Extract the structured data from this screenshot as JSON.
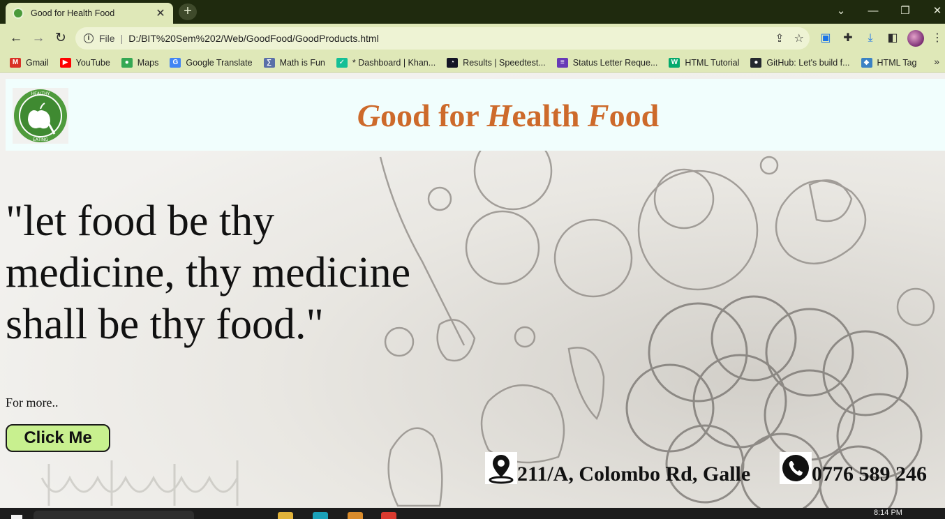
{
  "browser": {
    "tab_title": "Good for Health Food",
    "tab_close": "✕",
    "new_tab": "+",
    "address_scheme": "File",
    "address_sep": "|",
    "address_url": "D:/BIT%20Sem%202/Web/GoodFood/GoodProducts.html",
    "bookmarks": [
      {
        "label": "Gmail",
        "icon": "gmail-icon",
        "color": "#d93025",
        "glyph": "M"
      },
      {
        "label": "YouTube",
        "icon": "youtube-icon",
        "color": "#ff0000",
        "glyph": "▶"
      },
      {
        "label": "Maps",
        "icon": "maps-icon",
        "color": "#34a853",
        "glyph": "●"
      },
      {
        "label": "Google Translate",
        "icon": "translate-icon",
        "color": "#4285f4",
        "glyph": "G"
      },
      {
        "label": "Math is Fun",
        "icon": "mathisfun-icon",
        "color": "#5a6fa8",
        "glyph": "∑"
      },
      {
        "label": "* Dashboard | Khan...",
        "icon": "khan-icon",
        "color": "#14bf96",
        "glyph": "✓"
      },
      {
        "label": "Results | Speedtest...",
        "icon": "speedtest-icon",
        "color": "#141526",
        "glyph": "◔"
      },
      {
        "label": "Status Letter Reque...",
        "icon": "forms-icon",
        "color": "#673ab7",
        "glyph": "≡"
      },
      {
        "label": "HTML Tutorial",
        "icon": "w3schools-icon",
        "color": "#04aa6d",
        "glyph": "W"
      },
      {
        "label": "GitHub: Let's build f...",
        "icon": "github-icon",
        "color": "#24292f",
        "glyph": "●"
      },
      {
        "label": "HTML  Tag",
        "icon": "html-tag-icon",
        "color": "#3b82c4",
        "glyph": "◆"
      }
    ],
    "bookmarks_more": "»"
  },
  "page": {
    "title_parts": [
      {
        "text": "G",
        "italic": true
      },
      {
        "text": "ood for ",
        "italic": false
      },
      {
        "text": "H",
        "italic": true
      },
      {
        "text": "ealth ",
        "italic": false
      },
      {
        "text": "F",
        "italic": true
      },
      {
        "text": "ood",
        "italic": false
      }
    ],
    "logo_text_top": "HEALTHY",
    "logo_text_bottom": "EATING",
    "quote": "\"let food be thy medicine, thy medicine shall be thy food.\"",
    "for_more": "For more..",
    "button_label": "Click Me",
    "address": "211/A, Colombo Rd, Galle",
    "phone": "0776 589 246",
    "title_color": "#cd6a2b",
    "header_bg": "#f1fefd",
    "button_bg": "#c8f08f"
  },
  "taskbar": {
    "time": "8:14 PM"
  }
}
